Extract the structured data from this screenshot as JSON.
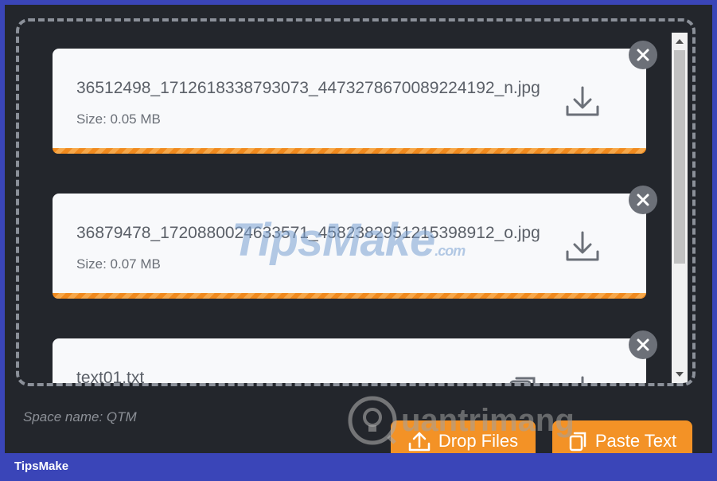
{
  "files": [
    {
      "name": "36512498_1712618338793073_4473278670089224192_n.jpg",
      "size": "Size: 0.05 MB",
      "progress": 1.0
    },
    {
      "name": "36879478_1720880024633571_4582382951215398912_o.jpg",
      "size": "Size: 0.07 MB",
      "progress": 1.0
    },
    {
      "name": "text01.txt",
      "size": "",
      "progress": 1.0
    }
  ],
  "space_name": "Space name: QTM",
  "buttons": {
    "drop_files": "Drop Files",
    "paste_text": "Paste Text"
  },
  "watermark": {
    "main": "TipsMake",
    "suffix": ".com"
  },
  "watermark2": {
    "text": "uantrimang"
  },
  "footer": {
    "brand": "TipsMake"
  },
  "colors": {
    "accent": "#f39226",
    "background": "#23262c",
    "card": "#f8f9fb",
    "footer": "#3a45b8"
  }
}
